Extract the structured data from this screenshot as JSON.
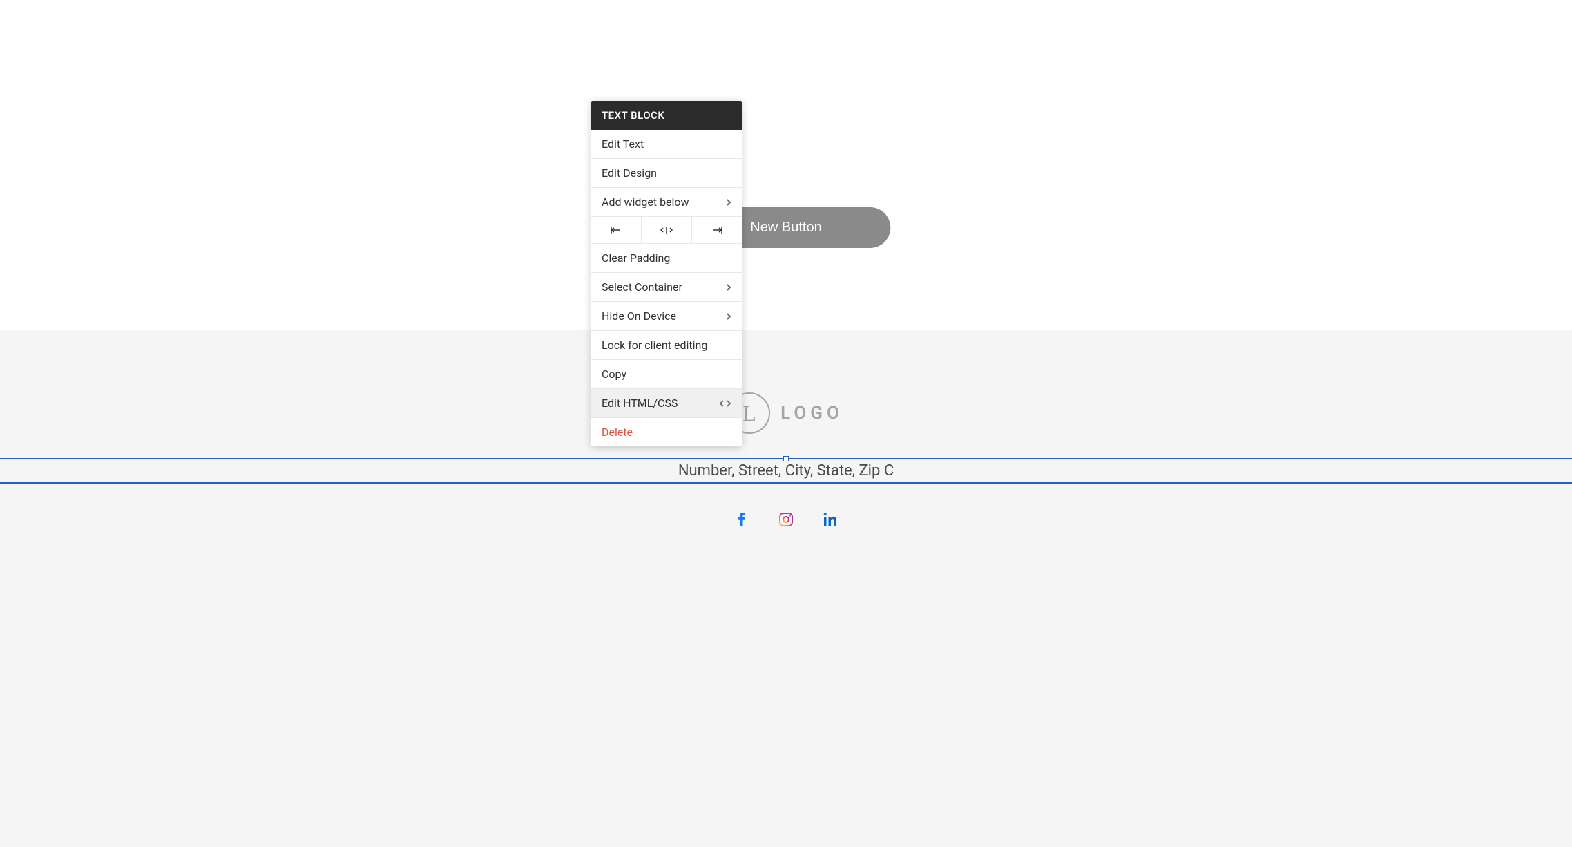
{
  "canvas": {
    "new_button_label": "New Button"
  },
  "footer": {
    "logo_letter": "L",
    "logo_text": "LOGO",
    "address": "Number, Street, City, State, Zip C"
  },
  "context_menu": {
    "header": "TEXT BLOCK",
    "items": {
      "edit_text": "Edit Text",
      "edit_design": "Edit Design",
      "add_widget": "Add widget below",
      "clear_padding": "Clear Padding",
      "select_container": "Select Container",
      "hide_on_device": "Hide On Device",
      "lock_editing": "Lock for client editing",
      "copy": "Copy",
      "edit_html": "Edit HTML/CSS",
      "delete": "Delete"
    }
  }
}
